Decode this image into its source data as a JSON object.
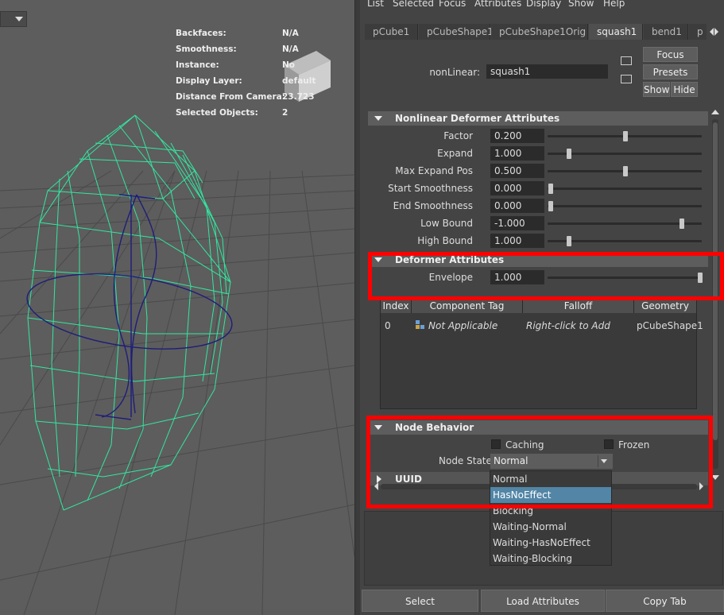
{
  "hud": {
    "rows": [
      {
        "label": "Backfaces:",
        "value": "N/A"
      },
      {
        "label": "Smoothness:",
        "value": "N/A"
      },
      {
        "label": "Instance:",
        "value": "No"
      },
      {
        "label": "Display Layer:",
        "value": "default"
      },
      {
        "label": "Distance From Camera:",
        "value": "23.723"
      },
      {
        "label": "Selected Objects:",
        "value": "2"
      }
    ]
  },
  "menu": [
    "List",
    "Selected",
    "Focus",
    "Attributes",
    "Display",
    "Show",
    "Help"
  ],
  "tabs": [
    "pCube1",
    "pCubeShape1",
    "pCubeShape1Orig",
    "squash1",
    "bend1",
    "p"
  ],
  "active_tab": "squash1",
  "node": {
    "label": "nonLinear:",
    "value": "squash1"
  },
  "side_buttons": {
    "focus": "Focus",
    "presets": "Presets",
    "show": "Show",
    "hide": "Hide"
  },
  "sections": {
    "nonlinear": {
      "title": "Nonlinear Deformer Attributes",
      "attrs": [
        {
          "label": "Factor",
          "value": "0.200",
          "slider": 0.5
        },
        {
          "label": "Expand",
          "value": "1.000",
          "slider": 0.12
        },
        {
          "label": "Max Expand Pos",
          "value": "0.500",
          "slider": 0.5
        },
        {
          "label": "Start Smoothness",
          "value": "0.000",
          "slider": 0.0
        },
        {
          "label": "End Smoothness",
          "value": "0.000",
          "slider": 0.0
        },
        {
          "label": "Low Bound",
          "value": "-1.000",
          "slider": 0.88
        },
        {
          "label": "High Bound",
          "value": "1.000",
          "slider": 0.12
        }
      ]
    },
    "deformer": {
      "title": "Deformer Attributes",
      "envelope": {
        "label": "Envelope",
        "value": "1.000",
        "slider": 1.0
      }
    },
    "node_behavior": {
      "title": "Node Behavior",
      "caching_label": "Caching",
      "frozen_label": "Frozen",
      "node_state_label": "Node State",
      "node_state_value": "Normal",
      "options": [
        "Normal",
        "HasNoEffect",
        "Blocking",
        "Waiting-Normal",
        "Waiting-HasNoEffect",
        "Waiting-Blocking"
      ],
      "highlighted": "HasNoEffect"
    },
    "uuid": {
      "title": "UUID"
    }
  },
  "table": {
    "headers": [
      "Index",
      "Component Tag",
      "Falloff",
      "Geometry"
    ],
    "row": {
      "index": "0",
      "tag": "Not Applicable",
      "falloff": "Right-click to Add",
      "geometry": "pCubeShape1"
    }
  },
  "bottom": {
    "select": "Select",
    "load": "Load Attributes",
    "copy": "Copy Tab"
  },
  "colors": {
    "wireframe": "#33e6a0",
    "handle": "#1e1e7a",
    "highlight_box": "#ff0000",
    "selection": "#5285a6"
  }
}
